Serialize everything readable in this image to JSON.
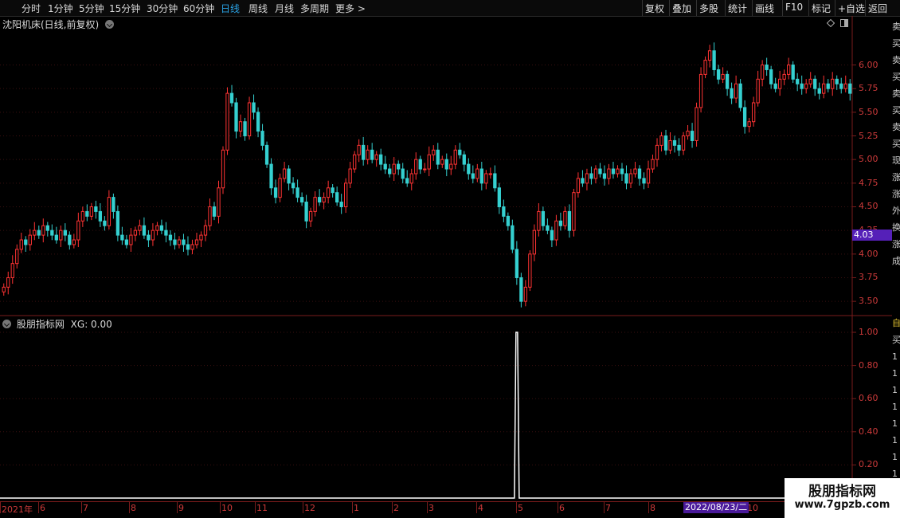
{
  "toolbar": {
    "periods": [
      "分时",
      "1分钟",
      "5分钟",
      "15分钟",
      "30分钟",
      "60分钟",
      "日线",
      "周线",
      "月线",
      "多周期",
      "更多 >"
    ],
    "active_period": "日线",
    "tools": [
      "复权",
      "叠加",
      "多股",
      "统计",
      "画线",
      "F10",
      "标记",
      "+自选",
      "返回"
    ]
  },
  "stock_title": "沈阳机床(日线,前复权)",
  "indicator": {
    "name": "股朋指标网",
    "value_text": "XG: 0.00"
  },
  "price_axis": [
    "6.00",
    "5.75",
    "5.50",
    "5.25",
    "5.00",
    "4.75",
    "4.50",
    "4.25",
    "4.00",
    "3.75",
    "3.50"
  ],
  "current_price_tag": "4.03",
  "ind_axis": [
    "1.00",
    "0.80",
    "0.60",
    "0.40",
    "0.20"
  ],
  "date_axis": [
    "2021年",
    "6",
    "7",
    "8",
    "9",
    "10",
    "11",
    "12",
    "1",
    "2",
    "3",
    "4",
    "5",
    "6",
    "7",
    "8",
    "10"
  ],
  "cursor_date": "2022/08/23/二",
  "right_strip_chars": [
    "卖",
    "买",
    "卖",
    "买",
    "卖",
    "买",
    "卖",
    "买",
    "现",
    "涨",
    "涨",
    "外",
    "换",
    "涨",
    "成"
  ],
  "right_strip_chars_lower": [
    "自",
    "买",
    "1",
    "1",
    "1",
    "1",
    "1",
    "1",
    "1",
    "1"
  ],
  "watermark": {
    "title": "股朋指标网",
    "url": "www.7gpzb.com"
  },
  "colors": {
    "up": "#ff3333",
    "down": "#35d0d0",
    "active": "#2aa3e6",
    "axis": "#cc3a3a",
    "tag": "#5520b8"
  },
  "chart_data": {
    "type": "candlestick",
    "title": "沈阳机床(日线,前复权)",
    "ylim": [
      3.4,
      6.35
    ],
    "closes": [
      3.65,
      3.75,
      3.9,
      4.05,
      4.15,
      4.1,
      4.2,
      4.25,
      4.2,
      4.3,
      4.25,
      4.2,
      4.15,
      4.25,
      4.2,
      4.1,
      4.15,
      4.35,
      4.45,
      4.4,
      4.5,
      4.45,
      4.35,
      4.3,
      4.6,
      4.45,
      4.2,
      4.15,
      4.1,
      4.2,
      4.25,
      4.3,
      4.2,
      4.15,
      4.25,
      4.3,
      4.25,
      4.2,
      4.15,
      4.1,
      4.15,
      4.1,
      4.05,
      4.1,
      4.15,
      4.2,
      4.3,
      4.5,
      4.4,
      4.7,
      5.1,
      5.7,
      5.6,
      5.3,
      5.4,
      5.25,
      5.6,
      5.5,
      5.3,
      5.15,
      4.95,
      4.7,
      4.6,
      4.8,
      4.9,
      4.75,
      4.7,
      4.6,
      4.55,
      4.35,
      4.45,
      4.6,
      4.55,
      4.6,
      4.7,
      4.65,
      4.55,
      4.5,
      4.75,
      4.9,
      5.05,
      5.15,
      5.0,
      5.1,
      5.0,
      5.05,
      4.95,
      4.9,
      4.85,
      4.95,
      4.9,
      4.8,
      4.75,
      4.85,
      5.0,
      4.9,
      4.9,
      5.05,
      5.1,
      4.95,
      5.0,
      4.9,
      4.95,
      5.1,
      5.05,
      4.95,
      4.85,
      4.8,
      4.9,
      4.75,
      4.85,
      4.85,
      4.7,
      4.5,
      4.4,
      4.3,
      4.05,
      3.75,
      3.5,
      3.65,
      4.0,
      4.25,
      4.45,
      4.3,
      4.25,
      4.15,
      4.35,
      4.3,
      4.45,
      4.25,
      4.65,
      4.8,
      4.75,
      4.85,
      4.8,
      4.9,
      4.85,
      4.8,
      4.9,
      4.85,
      4.9,
      4.85,
      4.75,
      4.85,
      4.9,
      4.8,
      4.75,
      4.9,
      5.0,
      5.15,
      5.25,
      5.1,
      5.2,
      5.15,
      5.1,
      5.25,
      5.3,
      5.2,
      5.55,
      5.9,
      6.05,
      6.15,
      5.95,
      5.85,
      5.9,
      5.75,
      5.65,
      5.8,
      5.55,
      5.35,
      5.4,
      5.6,
      5.85,
      6.0,
      5.95,
      5.8,
      5.75,
      5.85,
      5.9,
      6.0,
      5.85,
      5.8,
      5.75,
      5.8,
      5.85,
      5.75,
      5.7,
      5.8,
      5.75,
      5.85,
      5.8,
      5.75,
      5.8,
      5.7
    ],
    "xg_signal_index": 117,
    "xg_ylim": [
      0,
      1.0
    ]
  }
}
